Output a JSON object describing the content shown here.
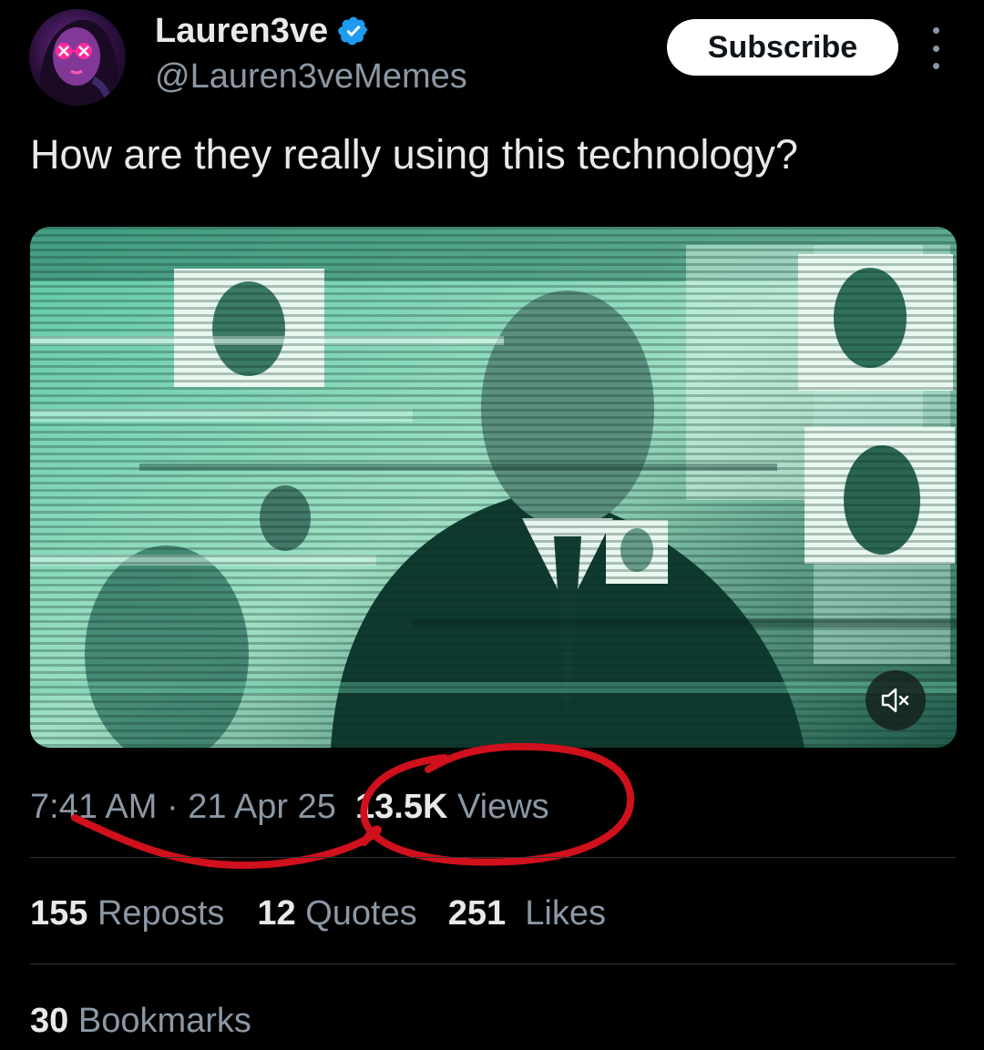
{
  "author": {
    "display_name": "Lauren3ve",
    "handle": "@Lauren3veMemes",
    "verified": true,
    "avatar_icon": "avatar-icon"
  },
  "header": {
    "subscribe_label": "Subscribe",
    "more_icon": "more-vertical-icon"
  },
  "tweet": {
    "text": "How are they really using this technology?",
    "media": {
      "type": "video",
      "muted": true,
      "mute_icon": "speaker-muted-icon"
    }
  },
  "meta": {
    "time": "7:41 AM",
    "separator": " · ",
    "date": "21 Apr 25",
    "views_count": "13.5K",
    "views_label": "Views"
  },
  "stats": {
    "reposts_count": "155",
    "reposts_label": "Reposts",
    "quotes_count": "12",
    "quotes_label": "Quotes",
    "likes_count": "251",
    "likes_label": "Likes",
    "bookmarks_count": "30",
    "bookmarks_label": "Bookmarks"
  },
  "colors": {
    "background": "#000000",
    "text_primary": "#e7e9ea",
    "text_secondary": "#8b98a5",
    "verified_badge": "#1d9bf0",
    "annotation_red": "#d0101c",
    "video_tint": "#3fae8f"
  }
}
